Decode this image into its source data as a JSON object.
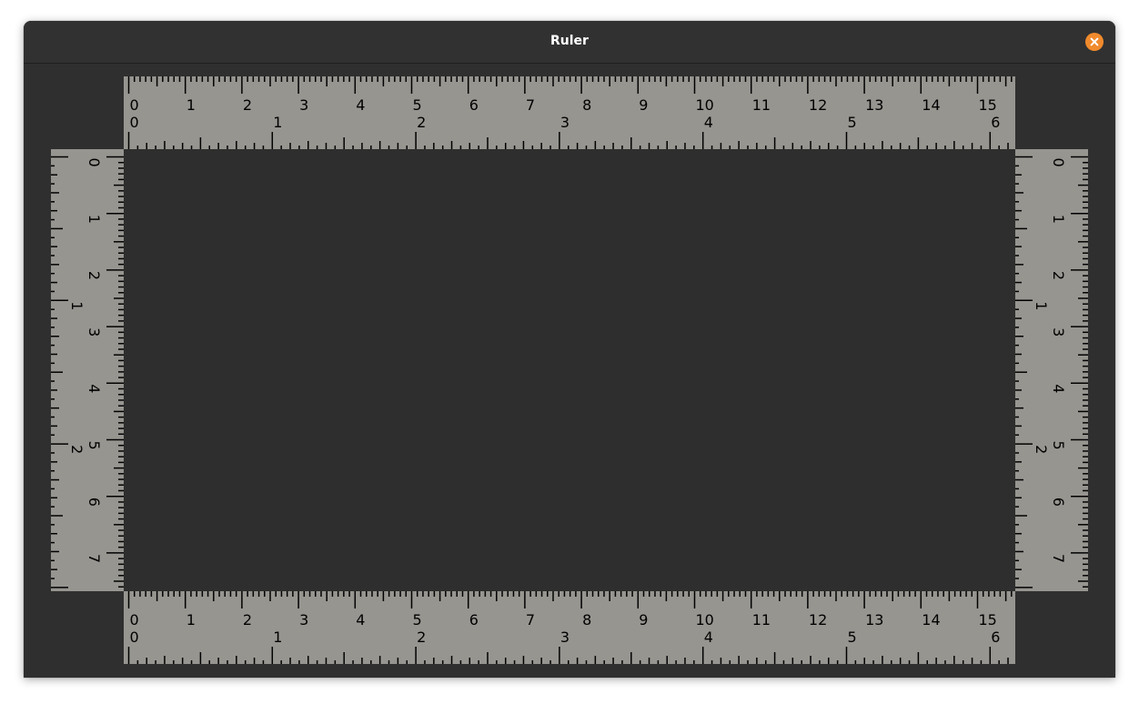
{
  "window": {
    "title": "Ruler",
    "close_icon": "close-icon",
    "close_color": "#f08a2c"
  },
  "colors": {
    "ruler_face": "#979590",
    "tick": "#000000",
    "background": "#2f2f2f"
  },
  "rulers": {
    "top": {
      "primary_unit": "cm",
      "primary_labels": [
        "0",
        "1",
        "2",
        "3",
        "4",
        "5",
        "6",
        "7",
        "8",
        "9",
        "10",
        "11",
        "12",
        "13",
        "14",
        "15"
      ],
      "secondary_unit": "in",
      "secondary_labels": [
        "0",
        "1",
        "2",
        "3",
        "4",
        "5",
        "6"
      ]
    },
    "bottom": {
      "primary_unit": "cm",
      "primary_labels": [
        "0",
        "1",
        "2",
        "3",
        "4",
        "5",
        "6",
        "7",
        "8",
        "9",
        "10",
        "11",
        "12",
        "13",
        "14",
        "15"
      ],
      "secondary_unit": "in",
      "secondary_labels": [
        "0",
        "1",
        "2",
        "3",
        "4",
        "5",
        "6"
      ]
    },
    "left": {
      "primary_unit": "cm",
      "primary_labels": [
        "0",
        "1",
        "2",
        "3",
        "4",
        "5",
        "6",
        "7"
      ],
      "secondary_unit": "in",
      "secondary_labels": [
        "1",
        "2"
      ]
    },
    "right": {
      "primary_unit": "cm",
      "primary_labels": [
        "0",
        "1",
        "2",
        "3",
        "4",
        "5",
        "6",
        "7"
      ],
      "secondary_unit": "in",
      "secondary_labels": [
        "1",
        "2"
      ]
    }
  }
}
